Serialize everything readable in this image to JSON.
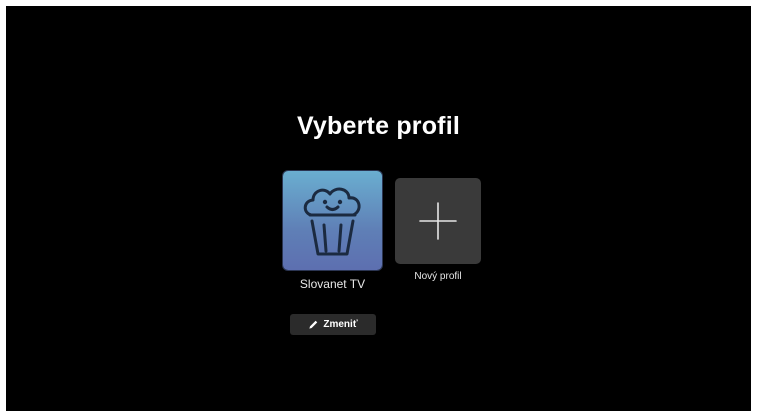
{
  "title": "Vyberte profil",
  "profiles": [
    {
      "label": "Slovanet TV",
      "icon": "popcorn-icon"
    },
    {
      "label": "Nový profil",
      "icon": "plus-icon"
    }
  ],
  "edit_button": {
    "label": "Zmeniť",
    "icon": "pencil-icon"
  },
  "colors": {
    "background": "#000000",
    "tile_gradient_top": "#6aaed0",
    "tile_gradient_bottom": "#5d6fb0",
    "new_tile": "#3a3a3a",
    "button": "#2b2b2b"
  }
}
